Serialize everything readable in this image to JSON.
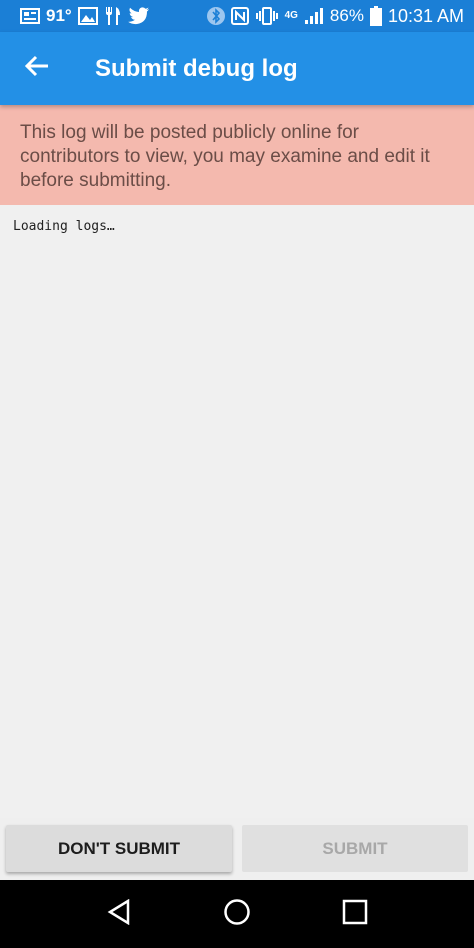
{
  "statusbar": {
    "temperature": "91°",
    "battery": "86%",
    "time": "10:31 AM",
    "network": "4G"
  },
  "appbar": {
    "title": "Submit debug log"
  },
  "warning": {
    "text": "This log will be posted publicly online for contributors to view, you may examine and edit it before submitting."
  },
  "log": {
    "text": "Loading logs…"
  },
  "buttons": {
    "dont_submit": "Don't submit",
    "submit": "Submit"
  },
  "colors": {
    "statusbar": "#1b7fd6",
    "appbar": "#2390e6",
    "warning_bg": "#f4b9ae",
    "log_bg": "#f0f0f0",
    "navbar": "#000000"
  }
}
